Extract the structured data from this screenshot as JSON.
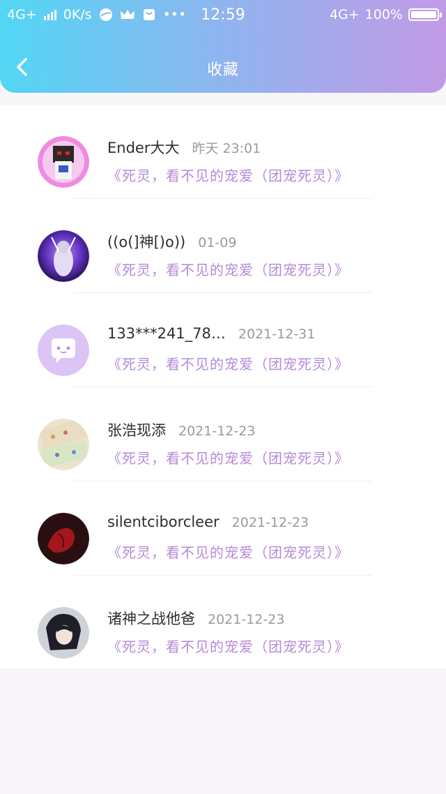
{
  "status_bar": {
    "network_left": "4G+",
    "speed": "0K/s",
    "time": "12:59",
    "network_right": "4G+",
    "battery": "100%"
  },
  "header": {
    "title": "收藏"
  },
  "favorites": [
    {
      "name": "Ender大大",
      "date": "昨天 23:01",
      "book": "《死灵，看不见的宠爱（团宠死灵）》"
    },
    {
      "name": "((o(]神[)o))",
      "date": "01-09",
      "book": "《死灵，看不见的宠爱（团宠死灵）》"
    },
    {
      "name": "133***241_78…",
      "date": "2021-12-31",
      "book": "《死灵，看不见的宠爱（团宠死灵）》"
    },
    {
      "name": "张浩现添",
      "date": "2021-12-23",
      "book": "《死灵，看不见的宠爱（团宠死灵）》"
    },
    {
      "name": "silentciborcleer",
      "date": "2021-12-23",
      "book": "《死灵，看不见的宠爱（团宠死灵）》"
    },
    {
      "name": "诸神之战他爸",
      "date": "2021-12-23",
      "book": "《死灵，看不见的宠爱（团宠死灵）》"
    }
  ],
  "colors": {
    "gradient_start": "#52d6f4",
    "gradient_end": "#c29ae6",
    "book_link": "#b58ad6",
    "date_text": "#9a9a9a"
  }
}
